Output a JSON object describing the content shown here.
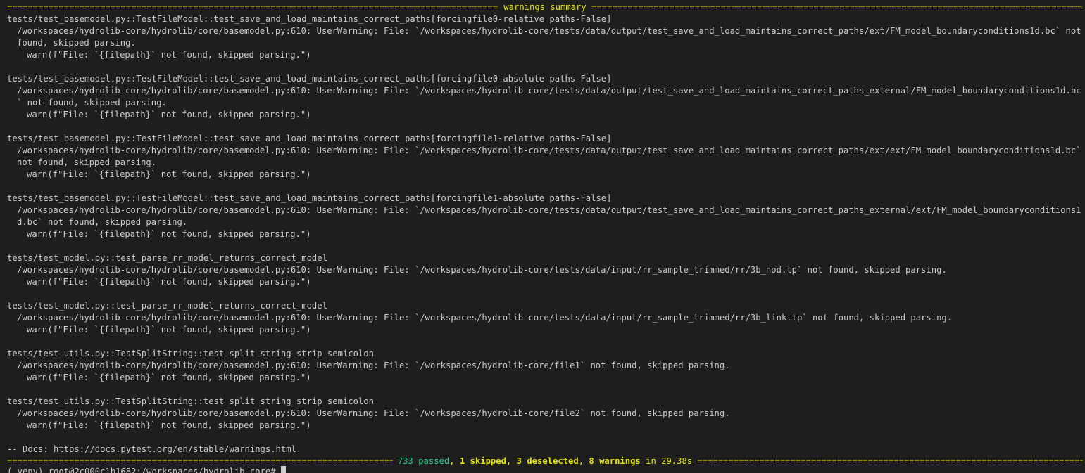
{
  "colors": {
    "background": "#1e1e1e",
    "text": "#cccccc",
    "yellow": "#e5e510",
    "green": "#23d18b"
  },
  "terminal": {
    "header_title": " warnings summary ",
    "warnings": [
      {
        "test": "tests/test_basemodel.py::TestFileModel::test_save_and_load_maintains_correct_paths[forcingfile0-relative paths-False]",
        "message": "/workspaces/hydrolib-core/hydrolib/core/basemodel.py:610: UserWarning: File: `/workspaces/hydrolib-core/tests/data/output/test_save_and_load_maintains_correct_paths/ext/FM_model_boundaryconditions1d.bc` not found, skipped parsing.",
        "source": "warn(f\"File: `{filepath}` not found, skipped parsing.\")"
      },
      {
        "test": "tests/test_basemodel.py::TestFileModel::test_save_and_load_maintains_correct_paths[forcingfile0-absolute paths-False]",
        "message": "/workspaces/hydrolib-core/hydrolib/core/basemodel.py:610: UserWarning: File: `/workspaces/hydrolib-core/tests/data/output/test_save_and_load_maintains_correct_paths_external/FM_model_boundaryconditions1d.bc` not found, skipped parsing.",
        "source": "warn(f\"File: `{filepath}` not found, skipped parsing.\")"
      },
      {
        "test": "tests/test_basemodel.py::TestFileModel::test_save_and_load_maintains_correct_paths[forcingfile1-relative paths-False]",
        "message": "/workspaces/hydrolib-core/hydrolib/core/basemodel.py:610: UserWarning: File: `/workspaces/hydrolib-core/tests/data/output/test_save_and_load_maintains_correct_paths/ext/ext/FM_model_boundaryconditions1d.bc` not found, skipped parsing.",
        "source": "warn(f\"File: `{filepath}` not found, skipped parsing.\")"
      },
      {
        "test": "tests/test_basemodel.py::TestFileModel::test_save_and_load_maintains_correct_paths[forcingfile1-absolute paths-False]",
        "message": "/workspaces/hydrolib-core/hydrolib/core/basemodel.py:610: UserWarning: File: `/workspaces/hydrolib-core/tests/data/output/test_save_and_load_maintains_correct_paths_external/ext/FM_model_boundaryconditions1d.bc` not found, skipped parsing.",
        "source": "warn(f\"File: `{filepath}` not found, skipped parsing.\")"
      },
      {
        "test": "tests/test_model.py::test_parse_rr_model_returns_correct_model",
        "message": "/workspaces/hydrolib-core/hydrolib/core/basemodel.py:610: UserWarning: File: `/workspaces/hydrolib-core/tests/data/input/rr_sample_trimmed/rr/3b_nod.tp` not found, skipped parsing.",
        "source": "warn(f\"File: `{filepath}` not found, skipped parsing.\")"
      },
      {
        "test": "tests/test_model.py::test_parse_rr_model_returns_correct_model",
        "message": "/workspaces/hydrolib-core/hydrolib/core/basemodel.py:610: UserWarning: File: `/workspaces/hydrolib-core/tests/data/input/rr_sample_trimmed/rr/3b_link.tp` not found, skipped parsing.",
        "source": "warn(f\"File: `{filepath}` not found, skipped parsing.\")"
      },
      {
        "test": "tests/test_utils.py::TestSplitString::test_split_string_strip_semicolon",
        "message": "/workspaces/hydrolib-core/hydrolib/core/basemodel.py:610: UserWarning: File: `/workspaces/hydrolib-core/file1` not found, skipped parsing.",
        "source": "warn(f\"File: `{filepath}` not found, skipped parsing.\")"
      },
      {
        "test": "tests/test_utils.py::TestSplitString::test_split_string_strip_semicolon",
        "message": "/workspaces/hydrolib-core/hydrolib/core/basemodel.py:610: UserWarning: File: `/workspaces/hydrolib-core/file2` not found, skipped parsing.",
        "source": "warn(f\"File: `{filepath}` not found, skipped parsing.\")"
      }
    ],
    "docs_line": "-- Docs: https://docs.pytest.org/en/stable/warnings.html",
    "summary": {
      "passed": "733 passed",
      "sep1": ", ",
      "skipped": "1 skipped",
      "sep2": ", ",
      "deselected": "3 deselected",
      "sep3": ", ",
      "warnings": "8 warnings",
      "time": " in 29.38s "
    },
    "prompt": "(.venv) root@2c000c1b1682:/workspaces/hydrolib-core# "
  }
}
